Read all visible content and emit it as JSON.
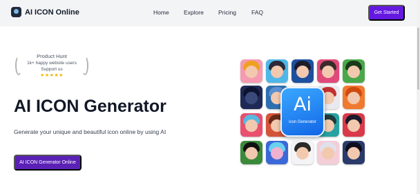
{
  "header": {
    "logo_text": "AI ICON Online",
    "nav": [
      "Home",
      "Explore",
      "Pricing",
      "FAQ"
    ],
    "cta_label": "Get Started"
  },
  "badge": {
    "title": "Product Hunt",
    "line1": "1k+ happy website users",
    "line2": "Support us",
    "stars": "★★★★★",
    "star_color": "#f5b400"
  },
  "hero": {
    "headline": "AI ICON Generator",
    "subtitle": "Generate your unique and beautiful icon online by using AI",
    "cta_label": "AI ICON Generator Online"
  },
  "showcase": {
    "feature_icon_text": "Ai",
    "feature_icon_caption": "icon Generator"
  },
  "colors": {
    "accent": "#6418e0",
    "button_purple": "#5b21b6",
    "header_bg": "#f3f4f6"
  }
}
